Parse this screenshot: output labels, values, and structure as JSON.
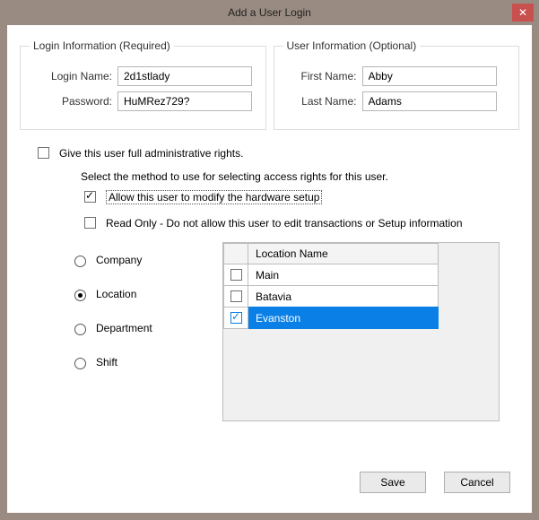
{
  "window": {
    "title": "Add a User Login"
  },
  "login_group": {
    "legend": "Login Information (Required)",
    "login_name_label": "Login Name:",
    "login_name_value": "2d1stlady",
    "password_label": "Password:",
    "password_value": "HuMRez729?"
  },
  "user_group": {
    "legend": "User Information (Optional)",
    "first_name_label": "First Name:",
    "first_name_value": "Abby",
    "last_name_label": "Last Name:",
    "last_name_value": "Adams"
  },
  "full_admin_label": "Give this user full administrative rights.",
  "instruction": "Select the method to use for selecting access rights for this user.",
  "allow_hw_label": "Allow this user to modify the hardware setup",
  "read_only_label": "Read Only - Do not allow this user to edit transactions or Setup information",
  "scope": {
    "company": "Company",
    "location": "Location",
    "department": "Department",
    "shift": "Shift"
  },
  "grid": {
    "header": "Location Name",
    "rows": [
      {
        "name": "Main",
        "checked": false,
        "selected": false
      },
      {
        "name": "Batavia",
        "checked": false,
        "selected": false
      },
      {
        "name": "Evanston",
        "checked": true,
        "selected": true
      }
    ]
  },
  "buttons": {
    "save": "Save",
    "cancel": "Cancel"
  }
}
